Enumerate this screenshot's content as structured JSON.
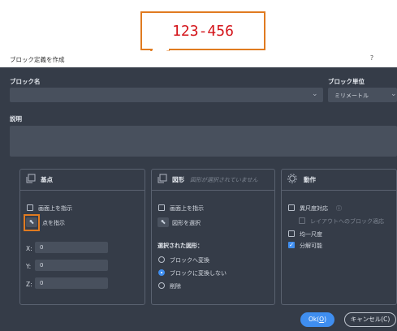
{
  "callout": {
    "text": "123-456"
  },
  "dialog": {
    "title": "ブロック定義を作成",
    "help": "?"
  },
  "block_name": {
    "label": "ブロック名",
    "value": ""
  },
  "block_unit": {
    "label": "ブロック単位",
    "value": "ミリメートル"
  },
  "description": {
    "label": "説明",
    "value": ""
  },
  "base_point": {
    "title": "基点",
    "specify_on_screen": "画面上を指示",
    "pick_point": "点を指示",
    "x_label": "X:",
    "x_value": "0",
    "y_label": "Y:",
    "y_value": "0",
    "z_label": "Z:",
    "z_value": "0"
  },
  "objects": {
    "title": "図形",
    "status": "図形が選択されていません",
    "specify_on_screen": "画面上を指示",
    "select_objects": "図形を選択",
    "selected_heading": "選択された図形：",
    "options": [
      "ブロックへ変換",
      "ブロックに変換しない",
      "削除"
    ],
    "selected_index": 1
  },
  "behavior": {
    "title": "動作",
    "annotative": "異尺度対応",
    "info": "ⓘ",
    "match_layout": "レイアウトへのブロック適応",
    "scale_uniformly": "均一尺度",
    "allow_explode": "分解可能",
    "allow_explode_checked": true
  },
  "buttons": {
    "ok": "Ok(O)",
    "ok_mnemonic": "O",
    "cancel": "キャンセル(C)"
  },
  "colors": {
    "accent": "#3f8ef0",
    "callout_border": "#e07b20",
    "callout_text": "#d4141a",
    "dialog_bg": "#353c48"
  }
}
